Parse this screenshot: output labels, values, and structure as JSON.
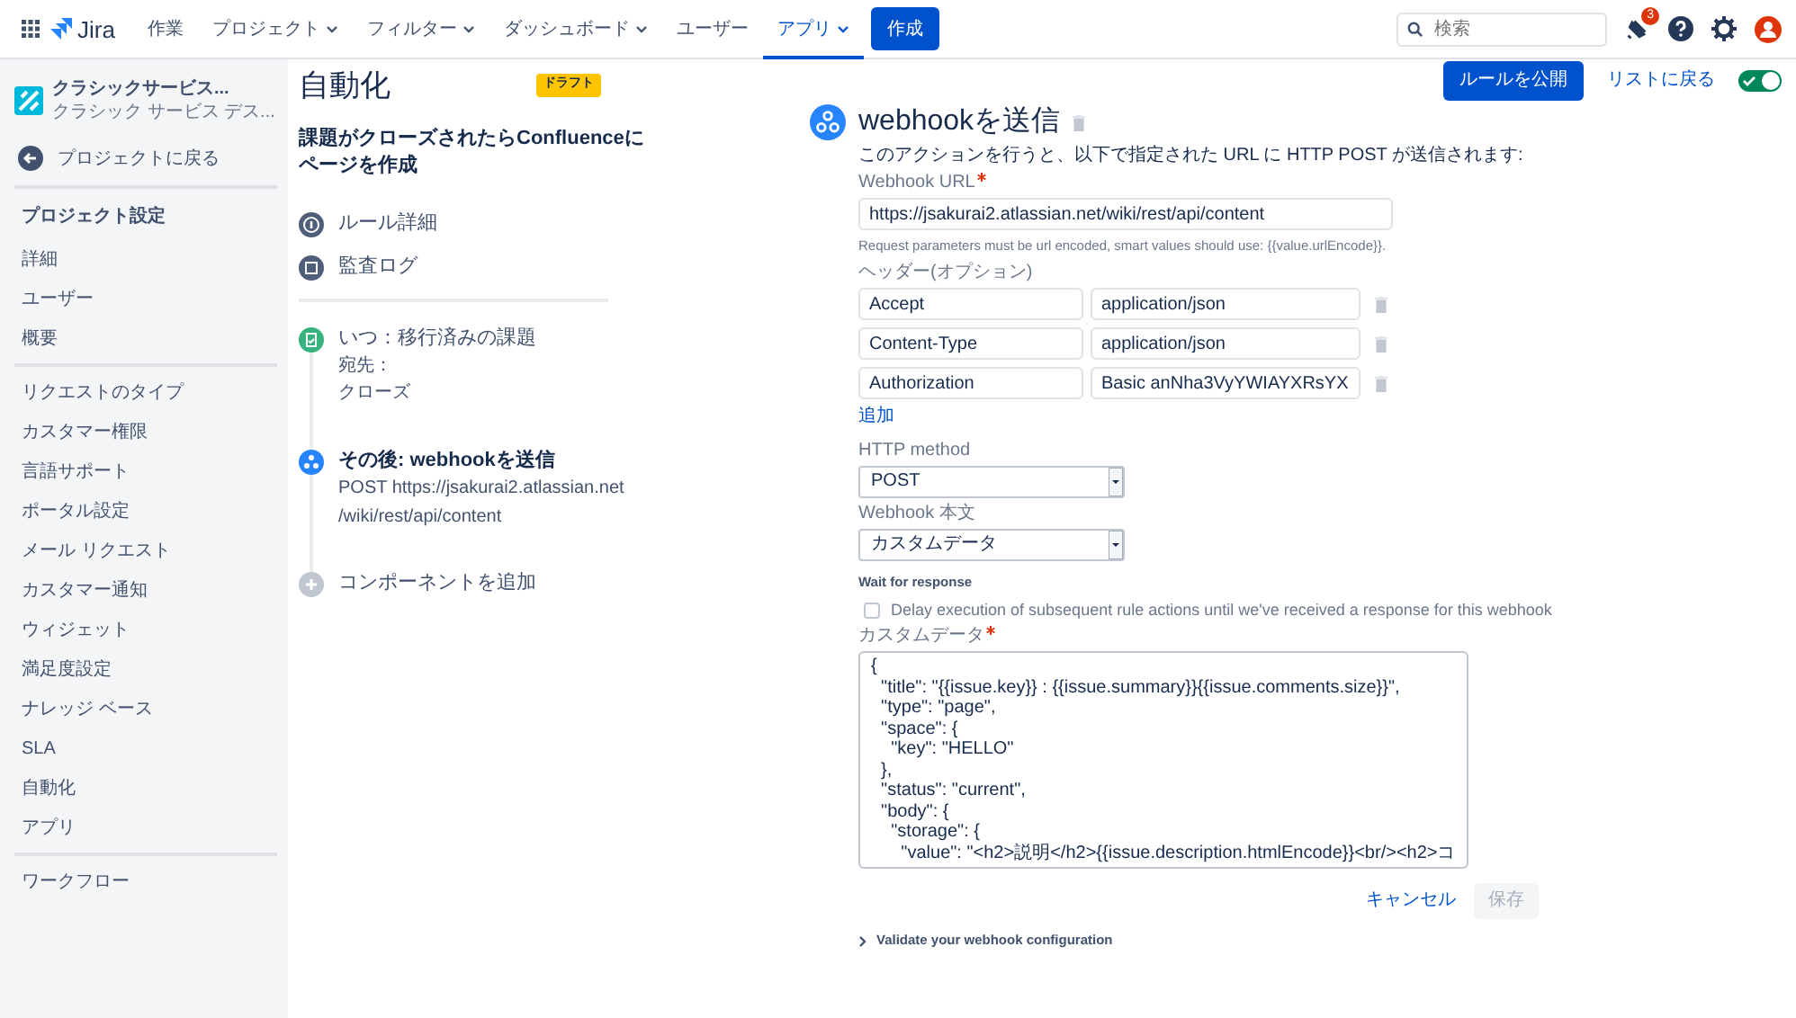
{
  "top_nav": {
    "product": "Jira",
    "items": [
      {
        "label": "作業",
        "dropdown": false,
        "selected": false
      },
      {
        "label": "プロジェクト",
        "dropdown": true,
        "selected": false
      },
      {
        "label": "フィルター",
        "dropdown": true,
        "selected": false
      },
      {
        "label": "ダッシュボード",
        "dropdown": true,
        "selected": false
      },
      {
        "label": "ユーザー",
        "dropdown": false,
        "selected": false
      },
      {
        "label": "アプリ",
        "dropdown": true,
        "selected": true
      }
    ],
    "create_button": "作成",
    "search": {
      "placeholder": "検索"
    },
    "notification_count": "3"
  },
  "sidebar": {
    "project": {
      "name": "クラシックサービス...",
      "subtitle": "クラシック サービス デス..."
    },
    "back_link": "プロジェクトに戻る",
    "section_title": "プロジェクト設定",
    "groups": [
      [
        {
          "label": "詳細",
          "selected": false
        },
        {
          "label": "ユーザー",
          "selected": false
        },
        {
          "label": "概要",
          "selected": false
        }
      ],
      [
        {
          "label": "リクエストのタイプ",
          "selected": false
        },
        {
          "label": "カスタマー権限",
          "selected": false
        },
        {
          "label": "言語サポート",
          "selected": false
        },
        {
          "label": "ポータル設定",
          "selected": false
        },
        {
          "label": "メール リクエスト",
          "selected": false
        },
        {
          "label": "カスタマー通知",
          "selected": false
        },
        {
          "label": "ウィジェット",
          "selected": false
        },
        {
          "label": "満足度設定",
          "selected": false
        },
        {
          "label": "ナレッジ ベース",
          "selected": false
        },
        {
          "label": "SLA",
          "selected": false
        },
        {
          "label": "自動化",
          "selected": false
        },
        {
          "label": "アプリ",
          "selected": false
        }
      ],
      [
        {
          "label": "ワークフロー",
          "selected": false
        }
      ]
    ]
  },
  "rule": {
    "page_title": "自動化",
    "status_badge": "ドラフト",
    "name": "課題がクローズされたらConfluenceにページを作成",
    "links": [
      {
        "kind": "details",
        "label": "ルール詳細"
      },
      {
        "kind": "audit",
        "label": "監査ログ"
      }
    ],
    "steps": [
      {
        "kind": "trigger",
        "title": "いつ：移行済みの課題",
        "detail_label": "宛先：",
        "detail_lines": [
          "クローズ"
        ],
        "selected": false
      },
      {
        "kind": "action",
        "title": "その後: webhookを送信",
        "detail_lines": [
          "POST https://jsakurai2.atlassian.net",
          "/wiki/rest/api/content"
        ],
        "selected": true
      },
      {
        "kind": "add",
        "title": "コンポーネントを追加"
      }
    ]
  },
  "header_actions": {
    "publish_button": "ルールを公開",
    "back_link": "リストに戻る",
    "enabled": true
  },
  "webhook": {
    "title": "webhookを送信",
    "description": "このアクションを行うと、以下で指定された URL に HTTP POST が送信されます:",
    "url": {
      "label": "Webhook URL",
      "required": true,
      "value": "https://jsakurai2.atlassian.net/wiki/rest/api/content",
      "hint": "Request parameters must be url encoded, smart values should use: {{value.urlEncode}}."
    },
    "headers_label": "ヘッダー(オプション)",
    "headers": [
      {
        "name": "Accept",
        "value": "application/json"
      },
      {
        "name": "Content-Type",
        "value": "application/json"
      },
      {
        "name": "Authorization",
        "value": "Basic anNha3VyYWIAYXRsYX"
      }
    ],
    "add_link": "追加",
    "method": {
      "label": "HTTP method",
      "value": "POST"
    },
    "body": {
      "label": "Webhook 本文",
      "value": "カスタムデータ"
    },
    "wait": {
      "label": "Wait for response",
      "checkbox": "Delay execution of subsequent rule actions until we've received a response for this webhook",
      "checked": false
    },
    "custom_data": {
      "label": "カスタムデータ",
      "required": true,
      "lines": [
        "{",
        "  \"title\": \"{{issue.key}} : {{issue.summary}}{{issue.comments.size}}\",",
        "  \"type\": \"page\",",
        "  \"space\": {",
        "    \"key\": \"HELLO\"",
        "  },",
        "  \"status\": \"current\",",
        "  \"body\": {",
        "    \"storage\": {",
        "      \"value\": \"<h2>説明</h2>{{issue.description.htmlEncode}}<br/><h2>コ"
      ]
    },
    "cancel_button": "キャンセル",
    "save_button": {
      "label": "保存",
      "disabled": true
    },
    "validate_link": "Validate your webhook configuration"
  }
}
